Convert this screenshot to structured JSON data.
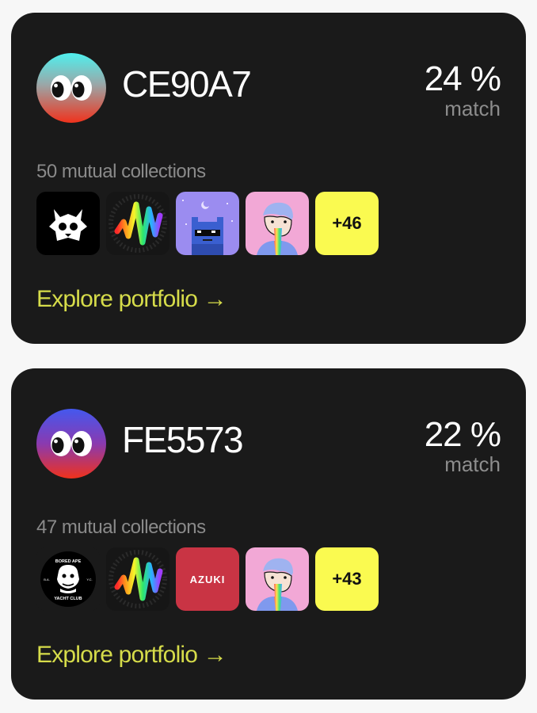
{
  "cards": [
    {
      "wallet_id": "CE90A7",
      "match_percent": "24 %",
      "match_label": "match",
      "mutual_collections": "50 mutual collections",
      "collections": [
        "dark-creature-nft",
        "rainbow-wave-nft",
        "pixel-blue-cat-nft",
        "rainbow-sick-kid-nft"
      ],
      "more_count": "+46",
      "explore_link": "Explore portfolio →"
    },
    {
      "wallet_id": "FE5573",
      "match_percent": "22 %",
      "match_label": "match",
      "mutual_collections": "47 mutual collections",
      "collections": [
        "bored-ape-yacht-club",
        "rainbow-wave-nft",
        "azuki",
        "rainbow-sick-kid-nft"
      ],
      "collection_texts": {
        "bayc_top": "BORED APE",
        "bayc_bottom": "YACHT CLUB",
        "bayc_left": "B.A.",
        "bayc_right": "Y.C.",
        "azuki": "AZUKI"
      },
      "more_count": "+43",
      "explore_link": "Explore portfolio →"
    }
  ],
  "colors": {
    "card_bg": "#1a1a1a",
    "accent_link": "#d6dc4a",
    "more_badge": "#fafa50",
    "muted_text": "#8a8a8a"
  }
}
